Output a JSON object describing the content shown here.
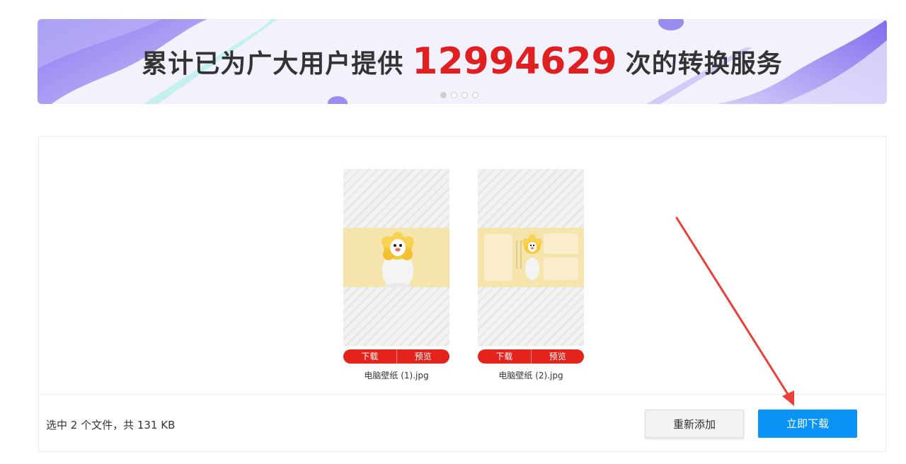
{
  "banner": {
    "prefix": "累计已为广大用户提供",
    "count": "12994629",
    "suffix": "次的转换服务",
    "slides": 4,
    "active_slide": 0
  },
  "files": [
    {
      "name": "电脑壁纸 (1).jpg",
      "download_label": "下载",
      "preview_label": "预览"
    },
    {
      "name": "电脑壁纸 (2).jpg",
      "download_label": "下载",
      "preview_label": "预览"
    }
  ],
  "footer": {
    "status": "选中 2 个文件，共 131 KB",
    "readd_label": "重新添加",
    "download_now_label": "立即下载"
  },
  "colors": {
    "accent_blue": "#0a93f5",
    "action_red": "#e3231c",
    "count_red": "#e02020",
    "annotation_arrow": "#e8403a"
  }
}
